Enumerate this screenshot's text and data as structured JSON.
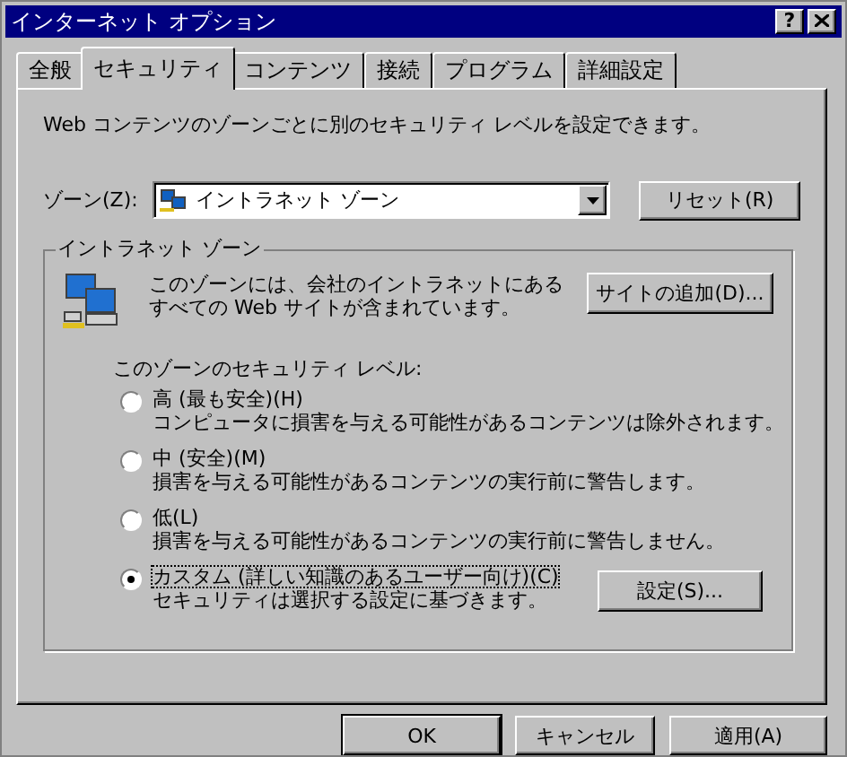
{
  "window": {
    "title": "インターネット オプション",
    "help_button": "?"
  },
  "tabs": [
    {
      "label": "全般",
      "selected": false
    },
    {
      "label": "セキュリティ",
      "selected": true
    },
    {
      "label": "コンテンツ",
      "selected": false
    },
    {
      "label": "接続",
      "selected": false
    },
    {
      "label": "プログラム",
      "selected": false
    },
    {
      "label": "詳細設定",
      "selected": false
    }
  ],
  "description": "Web コンテンツのゾーンごとに別のセキュリティ レベルを設定できます。",
  "zone": {
    "label": "ゾーン(Z):",
    "value": "イントラネット ゾーン",
    "reset_button": "リセット(R)"
  },
  "group": {
    "title": "イントラネット ゾーン",
    "text": "このゾーンには、会社のイントラネットにあるすべての Web サイトが含まれています。",
    "add_site_button": "サイトの追加(D)...",
    "level_label": "このゾーンのセキュリティ レベル:",
    "levels": [
      {
        "label": "高 (最も安全)(H)",
        "description": "コンピュータに損害を与える可能性があるコンテンツは除外されます。",
        "selected": false
      },
      {
        "label": "中 (安全)(M)",
        "description": "損害を与える可能性があるコンテンツの実行前に警告します。",
        "selected": false
      },
      {
        "label": "低(L)",
        "description": "損害を与える可能性があるコンテンツの実行前に警告しません。",
        "selected": false
      },
      {
        "label": "カスタム (詳しい知識のあるユーザー向け)(C)",
        "description": "セキュリティは選択する設定に基づきます。",
        "selected": true,
        "button": "設定(S)..."
      }
    ]
  },
  "buttons": [
    "OK",
    "キャンセル",
    "適用(A)"
  ]
}
